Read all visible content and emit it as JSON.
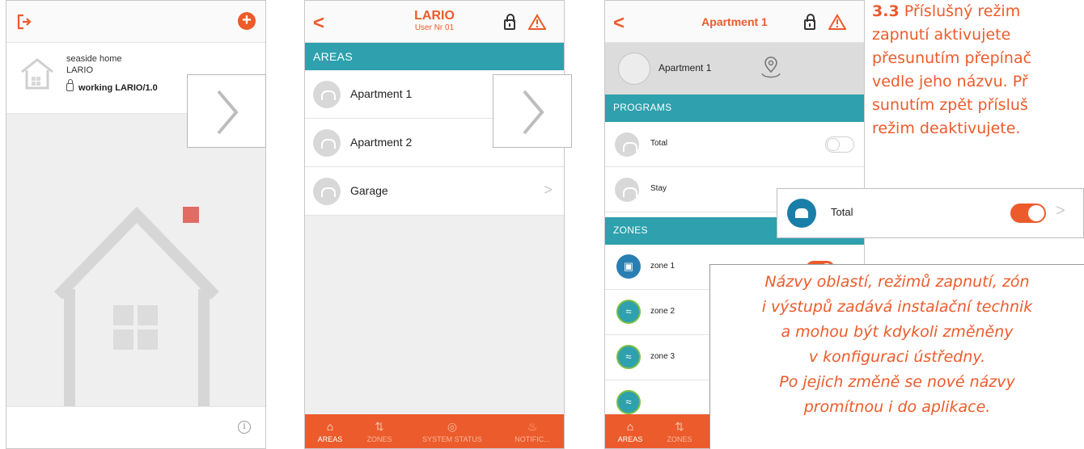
{
  "phone1": {
    "site": {
      "name": "seaside home",
      "sub": "LARIO",
      "status": "working LARIO/1.0"
    }
  },
  "phone2": {
    "header": {
      "title": "LARIO",
      "subtitle": "User Nr 01"
    },
    "section": "AREAS",
    "areas": [
      "Apartment 1",
      "Apartment 2",
      "Garage"
    ],
    "tabs": [
      "AREAS",
      "ZONES",
      "SYSTEM STATUS",
      "NOTIFIC..."
    ]
  },
  "phone3": {
    "header": {
      "title": "Apartment 1"
    },
    "hero": "Apartment 1",
    "programs_section": "PROGRAMS",
    "programs": [
      "Total",
      "Stay"
    ],
    "zones_section": "ZONES",
    "zones": [
      "zone 1",
      "zone 2",
      "zone 3"
    ],
    "tabs": [
      "AREAS",
      "ZONES"
    ]
  },
  "callout": {
    "label": "Total",
    "state": "on"
  },
  "instruction": {
    "step": "3.3",
    "line1": "Příslušný režim",
    "line2": "zapnutí aktivujete",
    "line3": "přesunutím přepínač",
    "line4": "vedle jeho názvu. Př",
    "line5": "sunutím zpět přísluš",
    "line6": "režim deaktivujete."
  },
  "note": {
    "line1": "Názvy oblastí, režimů zapnutí, zón",
    "line2": "i výstupů zadává instalační technik",
    "line3": "a mohou být kdykoli změněny",
    "line4": "v konfiguraci ústředny.",
    "line5": "Po jejich změně se nové názvy",
    "line6": "promítnou i do aplikace."
  },
  "colors": {
    "accent": "#ec5b2b",
    "teal": "#2fa0ad",
    "zone_blue": "#2a7fb2"
  }
}
